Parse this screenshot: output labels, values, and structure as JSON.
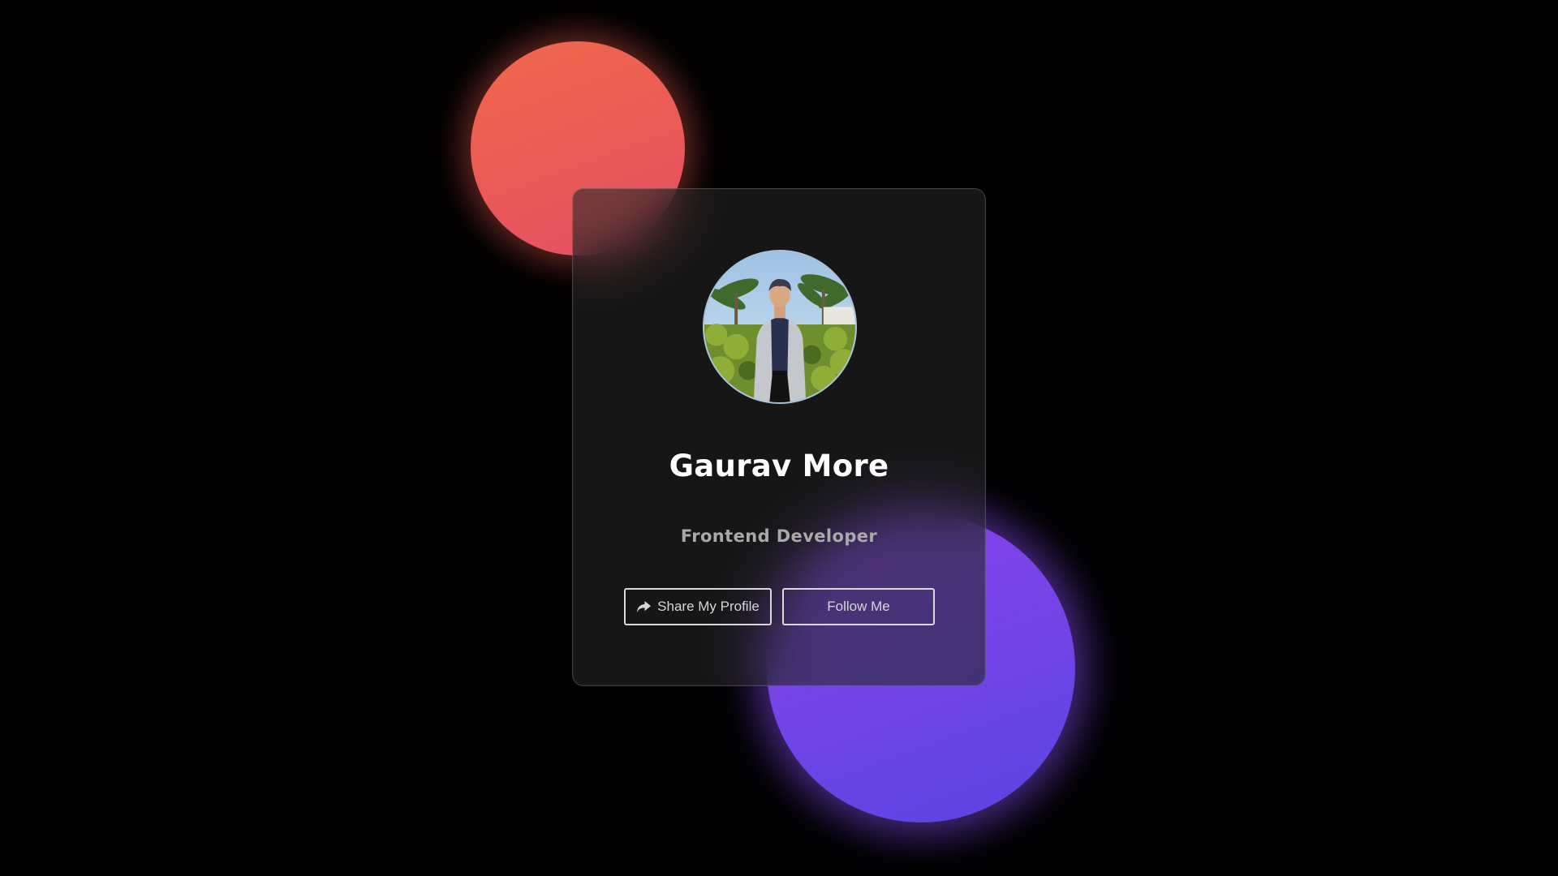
{
  "profile": {
    "name": "Gaurav More",
    "role": "Frontend Developer",
    "avatar_icon": "profile-photo"
  },
  "actions": {
    "share_label": "Share My Profile",
    "share_icon": "share-icon",
    "follow_label": "Follow Me"
  },
  "theme": {
    "background": "#000000",
    "card": "#262626",
    "coral_blob": "#ee5f55",
    "violet_blob": "#7044e8",
    "text": "#ffffff",
    "muted_text": "#a9a9a9",
    "button_border": "#d9d9d9"
  }
}
